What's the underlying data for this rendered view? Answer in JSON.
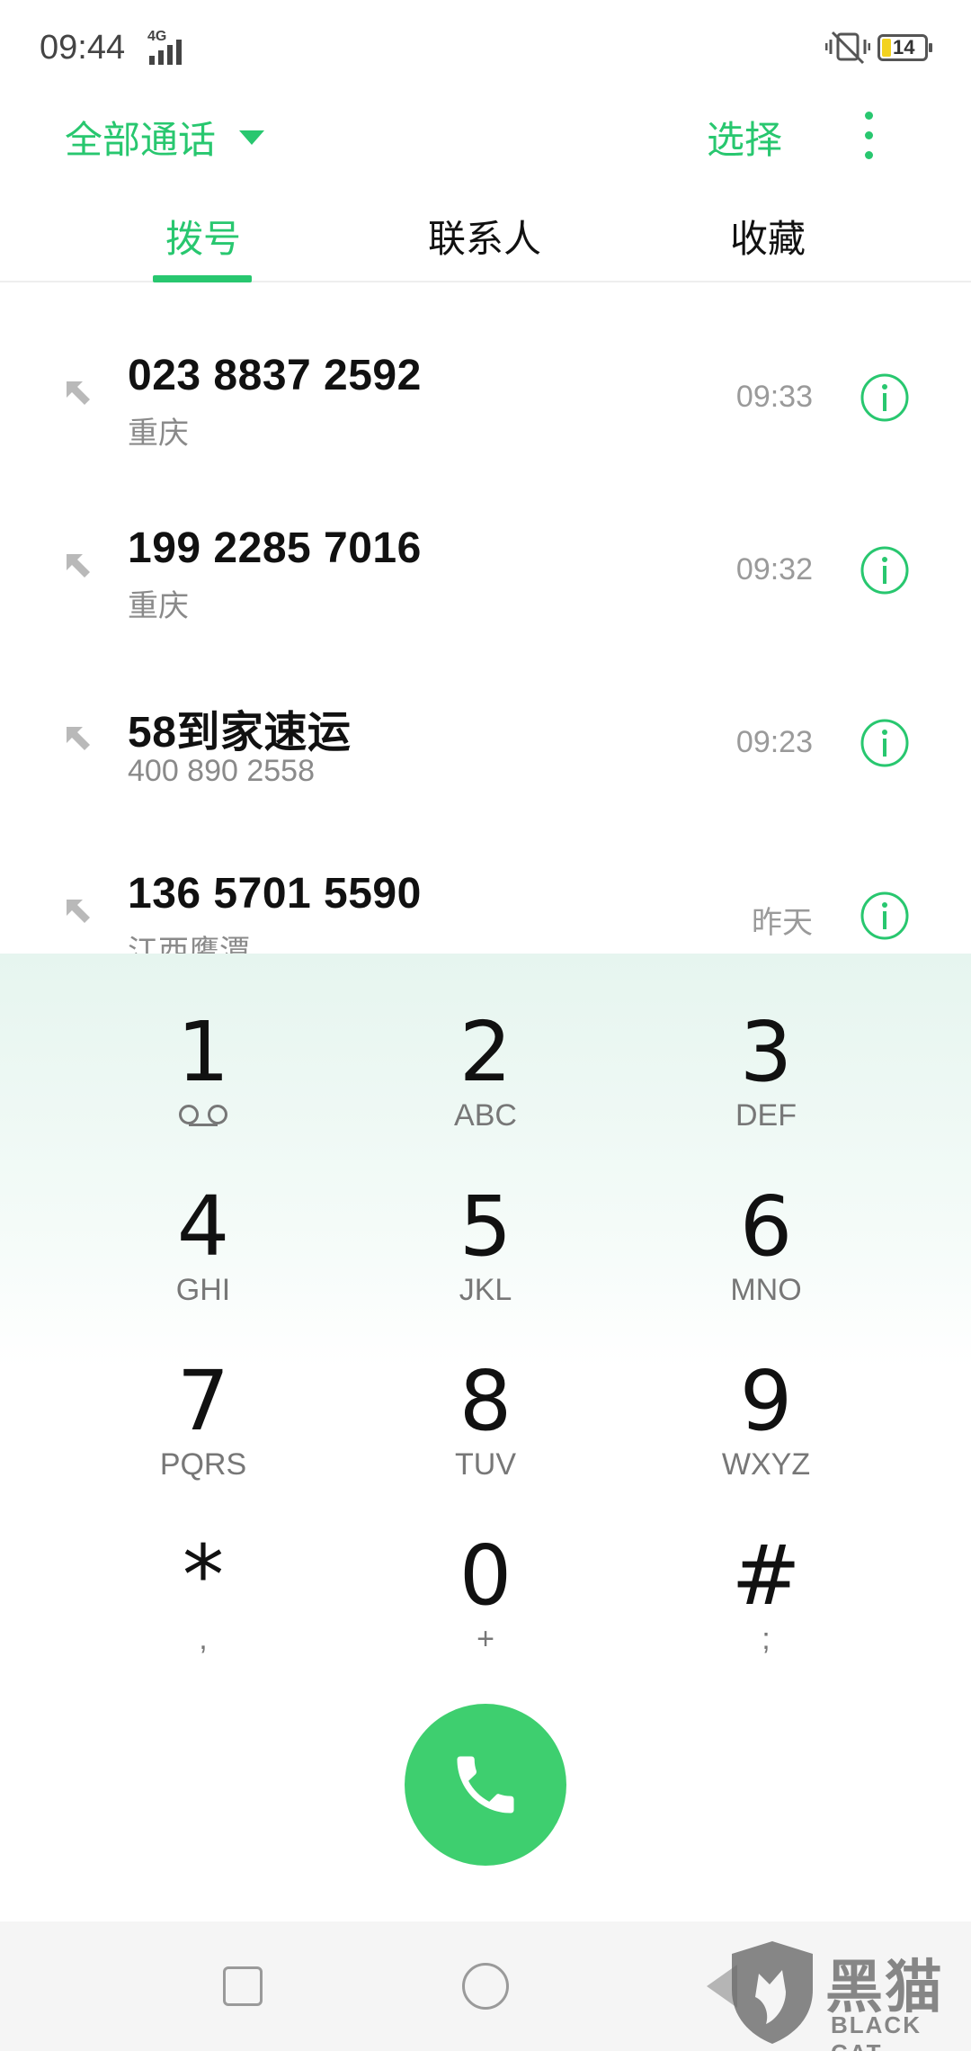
{
  "status_bar": {
    "time": "09:44",
    "network": "4G",
    "battery": "14",
    "battery_color": "#f3d21f"
  },
  "header": {
    "filter_label": "全部通话",
    "select_label": "选择",
    "more_icon": "more-vertical-icon"
  },
  "tabs": [
    {
      "label": "拨号",
      "active": true
    },
    {
      "label": "联系人",
      "active": false
    },
    {
      "label": "收藏",
      "active": false
    }
  ],
  "calls": [
    {
      "name": "023 8837 2592",
      "sub": "重庆",
      "time": "09:33"
    },
    {
      "name": "199 2285 7016",
      "sub": "重庆",
      "time": "09:32"
    },
    {
      "name": "58到家速运",
      "sub": "400 890 2558",
      "time": "09:23"
    },
    {
      "name": "136 5701 5590",
      "sub": "江西鹰潭",
      "time": "昨天"
    }
  ],
  "dialpad": [
    {
      "digit": "1",
      "letters": ""
    },
    {
      "digit": "2",
      "letters": "ABC"
    },
    {
      "digit": "3",
      "letters": "DEF"
    },
    {
      "digit": "4",
      "letters": "GHI"
    },
    {
      "digit": "5",
      "letters": "JKL"
    },
    {
      "digit": "6",
      "letters": "MNO"
    },
    {
      "digit": "7",
      "letters": "PQRS"
    },
    {
      "digit": "8",
      "letters": "TUV"
    },
    {
      "digit": "9",
      "letters": "WXYZ"
    },
    {
      "digit": "*",
      "letters": ","
    },
    {
      "digit": "0",
      "letters": "+"
    },
    {
      "digit": "#",
      "letters": ";"
    }
  ],
  "accent_color": "#28c76f",
  "call_button_color": "#3ecf6f",
  "watermark": {
    "title": "黑猫",
    "subtitle": "BLACK CAT"
  }
}
